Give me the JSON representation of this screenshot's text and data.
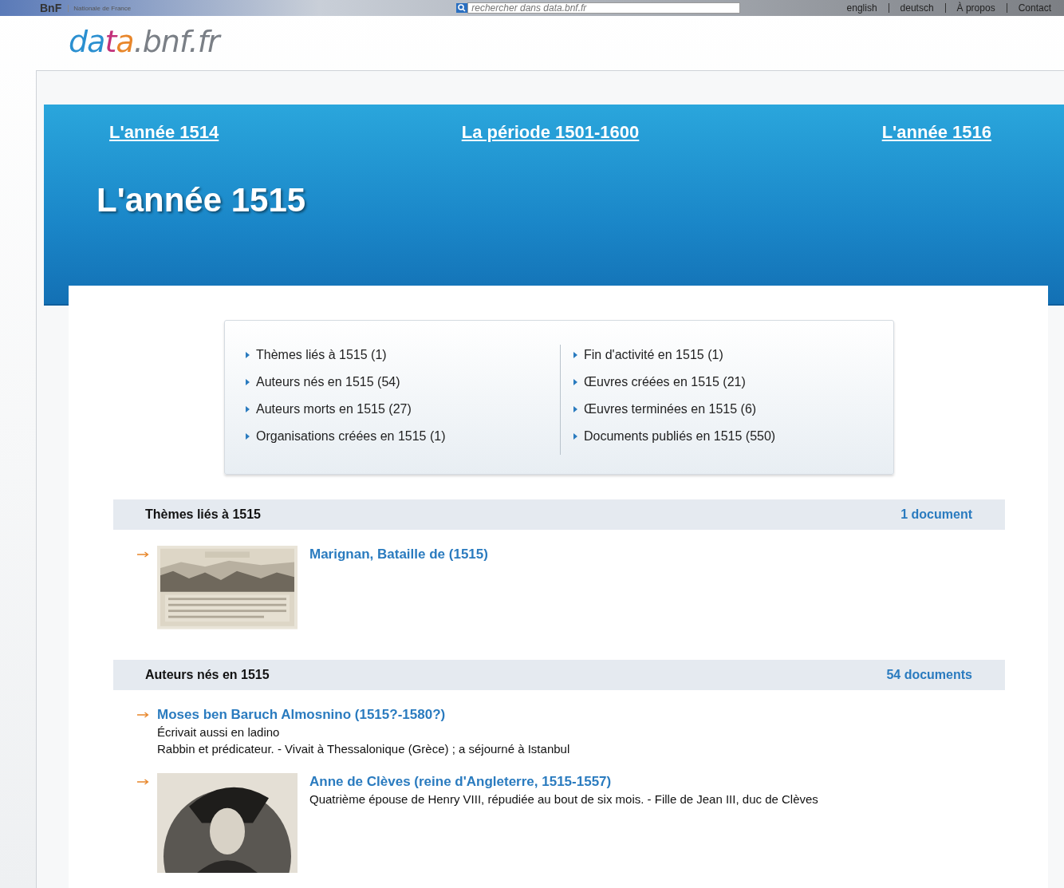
{
  "header": {
    "brand": "BnF",
    "org_label": "Nationale de France",
    "search": {
      "placeholder": "rechercher dans data.bnf.fr"
    },
    "nav_links": [
      "english",
      "deutsch",
      "À propos",
      "Contact"
    ],
    "logo": [
      {
        "text": "da",
        "color": "#2a8fd0"
      },
      {
        "text": "t",
        "color": "#c2307a"
      },
      {
        "text": "a",
        "color": "#e8862a"
      },
      {
        "text": ".bnf.fr",
        "color": "#7a7f86"
      }
    ]
  },
  "banner": {
    "prev": "L'année 1514",
    "period": "La période 1501-1600",
    "next": "L'année 1516",
    "title": "L'année 1515"
  },
  "summary": {
    "columns": [
      [
        "Thèmes liés à 1515 (1)",
        "Auteurs nés en 1515 (54)",
        "Auteurs morts en 1515 (27)",
        "Organisations créées en 1515 (1)"
      ],
      [
        "Fin d'activité en 1515 (1)",
        "Œuvres créées en 1515 (21)",
        "Œuvres terminées en 1515 (6)",
        "Documents publiés en 1515 (550)"
      ]
    ]
  },
  "sections": [
    {
      "title": "Thèmes liés à 1515",
      "count": "1 document",
      "items": [
        {
          "kind": "picture",
          "name": "Marignan, Bataille de (1515)"
        }
      ]
    },
    {
      "title": "Auteurs nés en 1515",
      "count": "54 documents",
      "items": [
        {
          "kind": "text",
          "name": "Moses ben Baruch Almosnino (1515?-1580?)",
          "lines": [
            "Écrivait aussi en ladino",
            "Rabbin et prédicateur. - Vivait à Thessalonique (Grèce) ; a séjourné à Istanbul"
          ]
        },
        {
          "kind": "picture",
          "name": "Anne de Clèves (reine d'Angleterre, 1515-1557)",
          "lines": [
            "Quatrième épouse de Henry VIII, répudiée au bout de six mois. - Fille de Jean III, duc de Clèves"
          ]
        }
      ]
    }
  ]
}
